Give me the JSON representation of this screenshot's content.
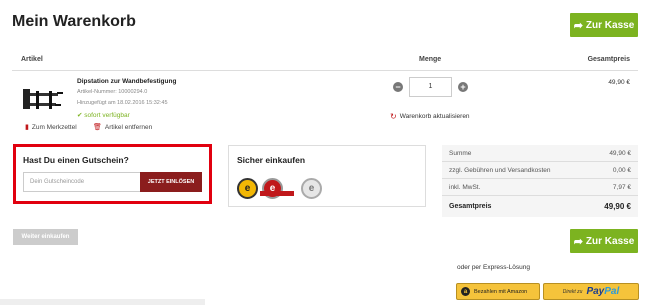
{
  "cart": {
    "title": "Mein Warenkorb"
  },
  "checkout": {
    "label": "Zur Kasse"
  },
  "table_headers": {
    "article": "Artikel",
    "quantity": "Menge",
    "total": "Gesamtpreis"
  },
  "product": {
    "name": "Dipstation zur Wandbefestigung",
    "article_number": "Artikel-Nummer: 10000294.0",
    "added": "Hinzugefügt am 18.02.2016 15:32:45",
    "availability": "sofort verfügbar",
    "quantity": "1",
    "price": "49,90 €"
  },
  "actions": {
    "wishlist": "Zum Merkzettel",
    "remove": "Artikel entfernen",
    "update_cart": "Warenkorb aktualisieren"
  },
  "coupon": {
    "title": "Hast Du einen Gutschein?",
    "placeholder": "Dein Gutscheincode",
    "button": "JETZT EINLÖSEN"
  },
  "secure": {
    "title": "Sicher einkaufen"
  },
  "summary": {
    "rows": [
      {
        "label": "Summe",
        "value": "49,90 €"
      },
      {
        "label": "zzgl. Gebühren und Versandkosten",
        "value": "0,00 €"
      },
      {
        "label": "inkl. MwSt.",
        "value": "7,97 €"
      }
    ],
    "total_label": "Gesamtpreis",
    "total_value": "49,90 €"
  },
  "continue": {
    "label": "Weiter einkaufen"
  },
  "express": {
    "text": "oder per Express-Lösung",
    "amazon_label": "Bezahlen mit Amazon",
    "paypal_prefix": "Direkt zu",
    "paypal_word_a": "Pay",
    "paypal_word_b": "Pal"
  },
  "colors": {
    "accent": "#7cb320",
    "danger": "#e1000f",
    "coupon_button": "#8b1d1d"
  },
  "icons": {
    "checkout": "arrow-share-icon",
    "wishlist": "bookmark-icon",
    "remove": "trash-icon",
    "refresh": "refresh-icon",
    "available": "check-icon"
  }
}
